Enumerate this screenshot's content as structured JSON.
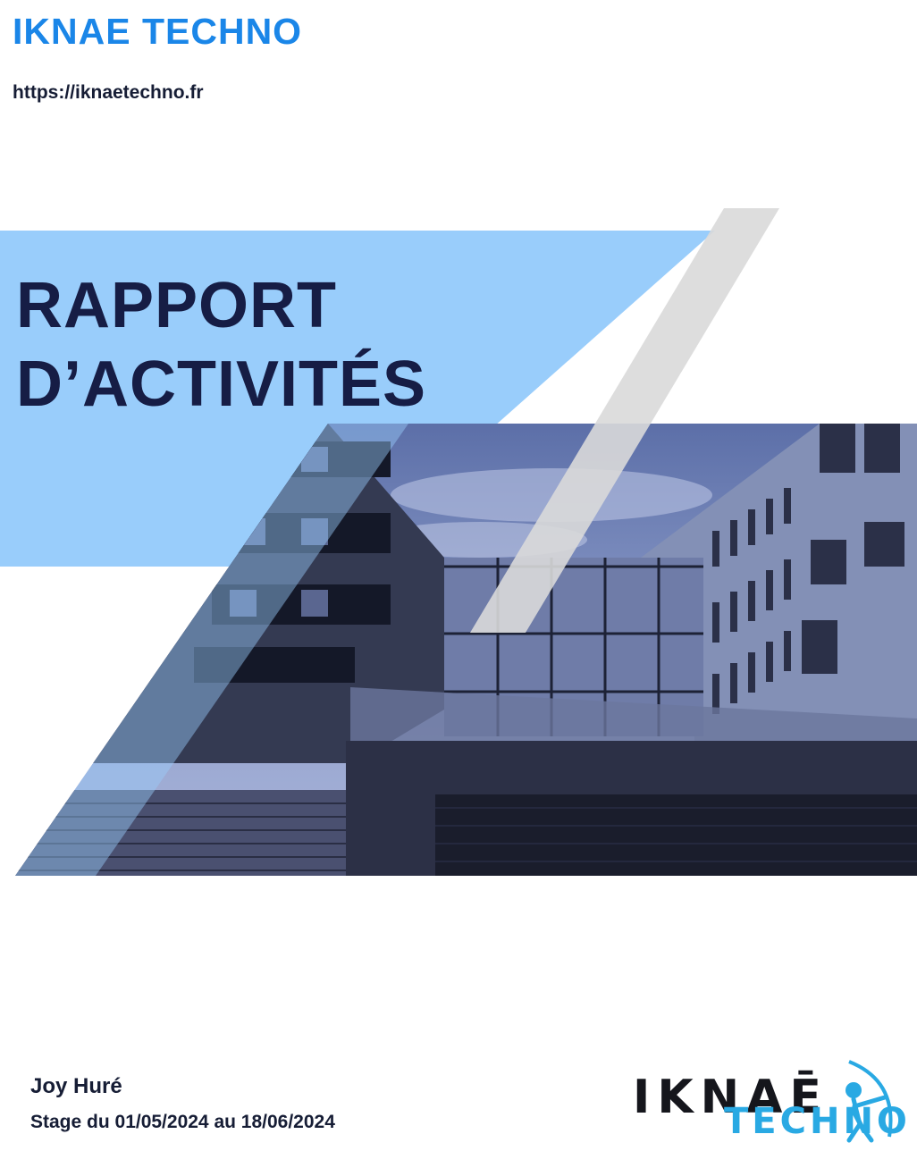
{
  "header": {
    "company": "IKNAE TECHNO",
    "website": "https://iknaetechno.fr"
  },
  "cover": {
    "title_line1": "RAPPORT",
    "title_line2": "D’ACTIVITÉS"
  },
  "footer": {
    "author": "Joy Huré",
    "period": "Stage du 01/05/2024 au 18/06/2024"
  },
  "logo": {
    "word1": "IKNAĒ",
    "word2": "TECHNO"
  },
  "colors": {
    "brand_blue": "#1a86e8",
    "band_blue": "#99cdfb",
    "title_navy": "#161d45",
    "logo_cyan": "#29a9e3"
  }
}
